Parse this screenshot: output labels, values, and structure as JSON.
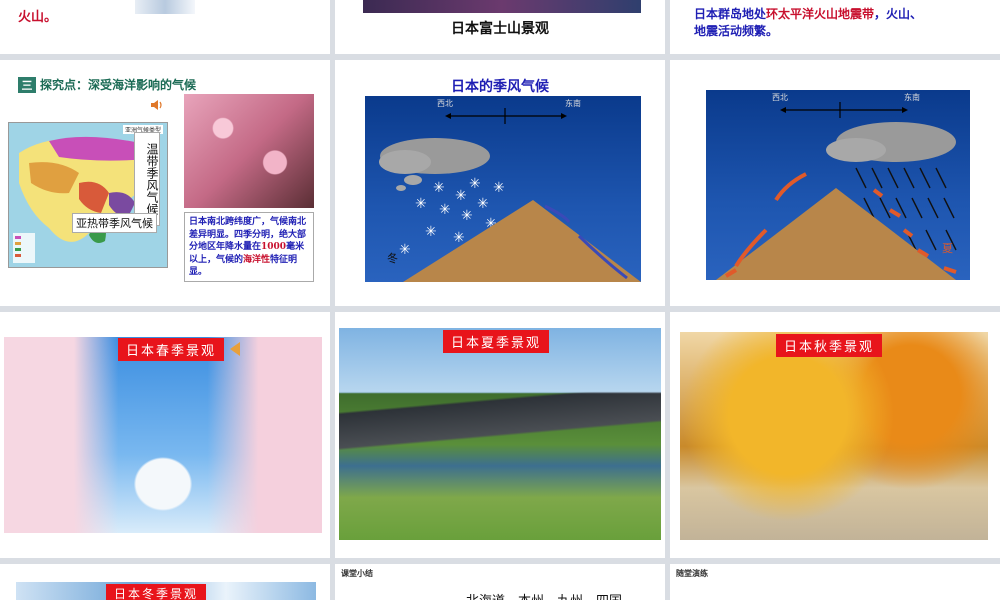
{
  "slide1": {
    "text": "火山。"
  },
  "slide2": {
    "caption": "日本富士山景观"
  },
  "slide3": {
    "line1_a": "日本群岛地处",
    "line1_hl": "环太平洋火山地震带",
    "line1_b": "，火山、",
    "line2": "地震活动频繁。"
  },
  "slide4": {
    "section_number": "三",
    "section_title": "探究点：深受海洋影响的气候",
    "map_title": "亚洲气候类型",
    "vertical_label": "温带季风气候",
    "horizontal_label": "亚热带季风气候",
    "note_a": "日本南北跨纬度广，气候南北差异明显。四季分明，绝大部分地区年降水量在",
    "note_num": "1000",
    "note_b": "毫米以上，气候的",
    "note_hl": "海洋性",
    "note_c": "特征明显。"
  },
  "slide5": {
    "title": "日本的季风气候",
    "west_label": "西北",
    "east_label": "东南",
    "season_label": "冬"
  },
  "slide6": {
    "west_label": "西北",
    "east_label": "东南",
    "season_label": "夏"
  },
  "slide7": {
    "tag": "日本春季景观"
  },
  "slide8": {
    "tag": "日本夏季景观"
  },
  "slide9": {
    "tag": "日本秋季景观"
  },
  "slide10": {
    "tag": "日本冬季景观"
  },
  "slide11": {
    "label": "课堂小结",
    "text": "…北海道、本州、九州、四国"
  },
  "slide12": {
    "label": "随堂演练"
  },
  "colors": {
    "red": "#c8102e",
    "blue": "#1f1fb4",
    "tag_red": "#e8141b",
    "sea": "#1e56b0",
    "mountain": "#b8864a"
  }
}
